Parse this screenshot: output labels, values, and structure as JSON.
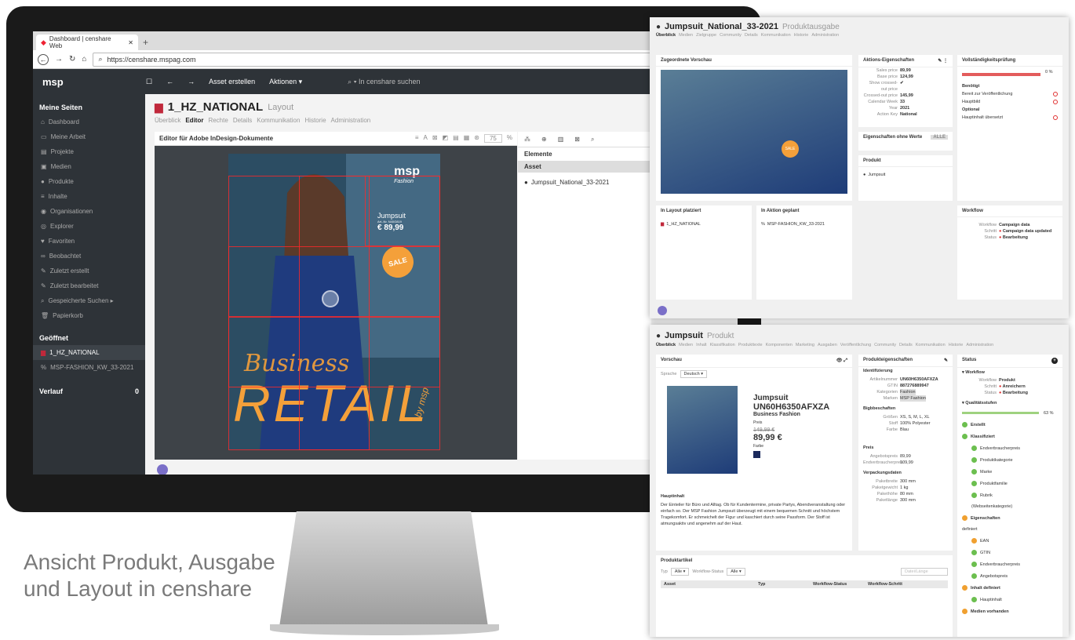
{
  "caption": {
    "line1": "Ansicht Produkt, Ausgabe",
    "line2": "und Layout in censhare"
  },
  "browser": {
    "tab_title": "Dashboard | censhare Web",
    "tab_close": "✕",
    "new_tab": "+",
    "url": "https://censhare.mspag.com",
    "go": "→"
  },
  "topbar": {
    "logo": "msp",
    "create_label": "Asset erstellen",
    "actions_label": "Aktionen ▾",
    "search_placeholder": "In censhare suchen"
  },
  "sidebar": {
    "my_pages": "Meine Seiten",
    "items": [
      "Dashboard",
      "Meine Arbeit",
      "Projekte",
      "Medien",
      "Produkte",
      "Inhalte",
      "Organisationen",
      "Explorer",
      "Favoriten",
      "Beobachtet",
      "Zuletzt erstellt",
      "Zuletzt bearbeitet",
      "Gespeicherte Suchen ▸",
      "Papierkorb"
    ],
    "opened": "Geöffnet",
    "opened_items": [
      "1_HZ_NATIONAL",
      "MSP-FASHION_KW_33-2021"
    ],
    "history": "Verlauf",
    "history_count": "0"
  },
  "main": {
    "title": "1_HZ_NATIONAL",
    "subtitle": "Layout",
    "tabs": [
      "Überblick",
      "Editor",
      "Rechte",
      "Details",
      "Kommunikation",
      "Historie",
      "Administration"
    ],
    "editor_title": "Editor für Adobe InDesign-Dokumente",
    "zoom": "75",
    "zoom_unit": "%",
    "page": {
      "brand": "msp",
      "brand_sub": "Fashion",
      "product": "Jumpsuit",
      "art_nr": "Art.-Nr. N40G819",
      "price": "€ 89,99",
      "badge": "SALE",
      "headline1": "Business",
      "headline2": "RETAIL",
      "signature": "by msp"
    }
  },
  "elements": {
    "title": "Elemente",
    "col_asset": "Asset",
    "row": "Jumpsuit_National_33-2021"
  },
  "shot1": {
    "title": "Jumpsuit_National_33-2021",
    "subtitle": "Produktausgabe",
    "tabs": [
      "Überblick",
      "Medien",
      "Zielgruppe",
      "Community",
      "Details",
      "Kommunikation",
      "Historie",
      "Administration"
    ],
    "preview_title": "Zugeordnete Vorschau",
    "action_title": "Aktions-Eigenschaften",
    "action_props": [
      {
        "k": "Sales price",
        "v": "89,99"
      },
      {
        "k": "Base price",
        "v": "124,99"
      },
      {
        "k": "Show crossed-out price",
        "v": "✔"
      },
      {
        "k": "Crossed-out price",
        "v": "145,99"
      },
      {
        "k": "Calendar Week",
        "v": "33"
      },
      {
        "k": "Year",
        "v": "2021"
      },
      {
        "k": "Action Key",
        "v": "National"
      }
    ],
    "no_values": "Eigenschaften ohne Werte",
    "no_values_btn": "ALLE",
    "product_title": "Produkt",
    "product_item": "Jumpsuit",
    "completeness_title": "Vollständigkeitsprüfung",
    "completeness_pct": "0 %",
    "needed": "Benötigt",
    "checks": [
      "Bereit zur Veröffentlichung",
      "Hauptbild"
    ],
    "optional": "Optional",
    "optional_checks": [
      "Hauptinhalt übersetzt"
    ],
    "layout_title": "In Layout platziert",
    "layout_item": "1_HZ_NATIONAL",
    "action_planned_title": "In Aktion geplant",
    "action_planned_item": "MSP-FASHION_KW_33-2021",
    "workflow_title": "Workflow",
    "workflow": [
      {
        "k": "Workflow",
        "v": "Campaign data"
      },
      {
        "k": "Schritt",
        "v": "Campaign data updated"
      },
      {
        "k": "Status",
        "v": "Bearbeitung"
      }
    ]
  },
  "shot2": {
    "title": "Jumpsuit",
    "subtitle": "Produkt",
    "tabs": [
      "Überblick",
      "Medien",
      "Inhalt",
      "Klassifikation",
      "Produkttexte",
      "Komponenten",
      "Marketing",
      "Ausgaben",
      "Veröffentlichung",
      "Community",
      "Details",
      "Kommunikation",
      "Historie",
      "Administration"
    ],
    "preview_title": "Vorschau",
    "lang_label": "Sprache",
    "lang_value": "Deutsch",
    "product_name": "Jumpsuit",
    "product_code": "UN60H6350AFXZA",
    "product_line": "Business Fashion",
    "price_label": "Preis",
    "old_price": "149,99 €",
    "price": "89,99 €",
    "color_label": "Farbe",
    "main_content_title": "Hauptinhalt",
    "main_content": "Der Einteiler für Büro und Alltag. Ob für Kundentermine, private Partys, Abendveranstaltung oder einfach so. Der MSP Fashion Jumpsuit überzeugt mit einem bequemen Schnitt und höchstem Tragekomfort. Er schmeichelt der Figur und kaschiert durch seine Passform. Der Stoff ist atmungsaktiv und angenehm auf der Haut.",
    "props_title": "Produkteigenschaften",
    "ident_title": "Identifizierung",
    "ident": [
      {
        "k": "Artikelnummer",
        "v": "UN60H6350AFXZA"
      },
      {
        "k": "GTIN",
        "v": "887276889947"
      },
      {
        "k": "Kategorien",
        "v": "Fashion"
      },
      {
        "k": "Marken",
        "v": "MSP Fashion"
      }
    ],
    "size_title": "Bigbbeschaften",
    "sizes": [
      {
        "k": "Größen",
        "v": "XS, S, M, L, XL"
      },
      {
        "k": "Stoff",
        "v": "100% Polyester"
      },
      {
        "k": "Farbe",
        "v": "Blau"
      }
    ],
    "price_title": "Preis",
    "prices": [
      {
        "k": "Angebotspreis",
        "v": "89,99"
      },
      {
        "k": "Endverbraucherpreis",
        "v": "109,99"
      }
    ],
    "pack_title": "Verpackungsdaten",
    "pack": [
      {
        "k": "Paketbreite",
        "v": "300 mm"
      },
      {
        "k": "Paketgewicht",
        "v": "1 kg"
      },
      {
        "k": "Pakethöhe",
        "v": "80 mm"
      },
      {
        "k": "Paketlänge",
        "v": "300 mm"
      }
    ],
    "status_title": "Status",
    "workflow_title": "▾ Workflow",
    "workflow": [
      {
        "k": "Workflow",
        "v": "Produkt"
      },
      {
        "k": "Schritt",
        "v": "Anreichern"
      },
      {
        "k": "Status",
        "v": "Bearbeitung"
      }
    ],
    "quality_title": "▾ Qualitätsstufen",
    "quality_pct": "63 %",
    "quality_items": [
      {
        "label": "Erstellt",
        "state": "g",
        "sub": false
      },
      {
        "label": "Klassifiziert",
        "state": "g",
        "sub": false
      },
      {
        "label": "Endverbraucherpreis",
        "state": "g",
        "sub": true
      },
      {
        "label": "Produktkategorie",
        "state": "g",
        "sub": true
      },
      {
        "label": "Marke",
        "state": "g",
        "sub": true
      },
      {
        "label": "Produktfamilie",
        "state": "g",
        "sub": true
      },
      {
        "label": "Rubrik",
        "state": "g",
        "sub": true
      },
      {
        "label": "(Webseitenkategorie)",
        "state": "",
        "sub": true
      },
      {
        "label": "Eigenschaften",
        "state": "o",
        "sub": false
      },
      {
        "label": "definiert",
        "state": "",
        "sub": false
      },
      {
        "label": "EAN",
        "state": "o",
        "sub": true
      },
      {
        "label": "GTIN",
        "state": "g",
        "sub": true
      },
      {
        "label": "Endverbraucherpreis",
        "state": "g",
        "sub": true
      },
      {
        "label": "Angebotspreis",
        "state": "g",
        "sub": true
      },
      {
        "label": "Inhalt definiert",
        "state": "o",
        "sub": false
      },
      {
        "label": "Hauptinhalt",
        "state": "g",
        "sub": true
      },
      {
        "label": "Medien vorhanden",
        "state": "o",
        "sub": false
      }
    ],
    "articles_title": "Produktartikel",
    "filter_type": "Typ",
    "filter_type_val": "Alle",
    "filter_wf": "Workflow-Status",
    "filter_wf_val": "Alle",
    "filter_placeholder": "Datei/Länge",
    "cols": [
      "Asset",
      "Typ",
      "Workflow-Status",
      "Workflow-Schritt"
    ]
  }
}
